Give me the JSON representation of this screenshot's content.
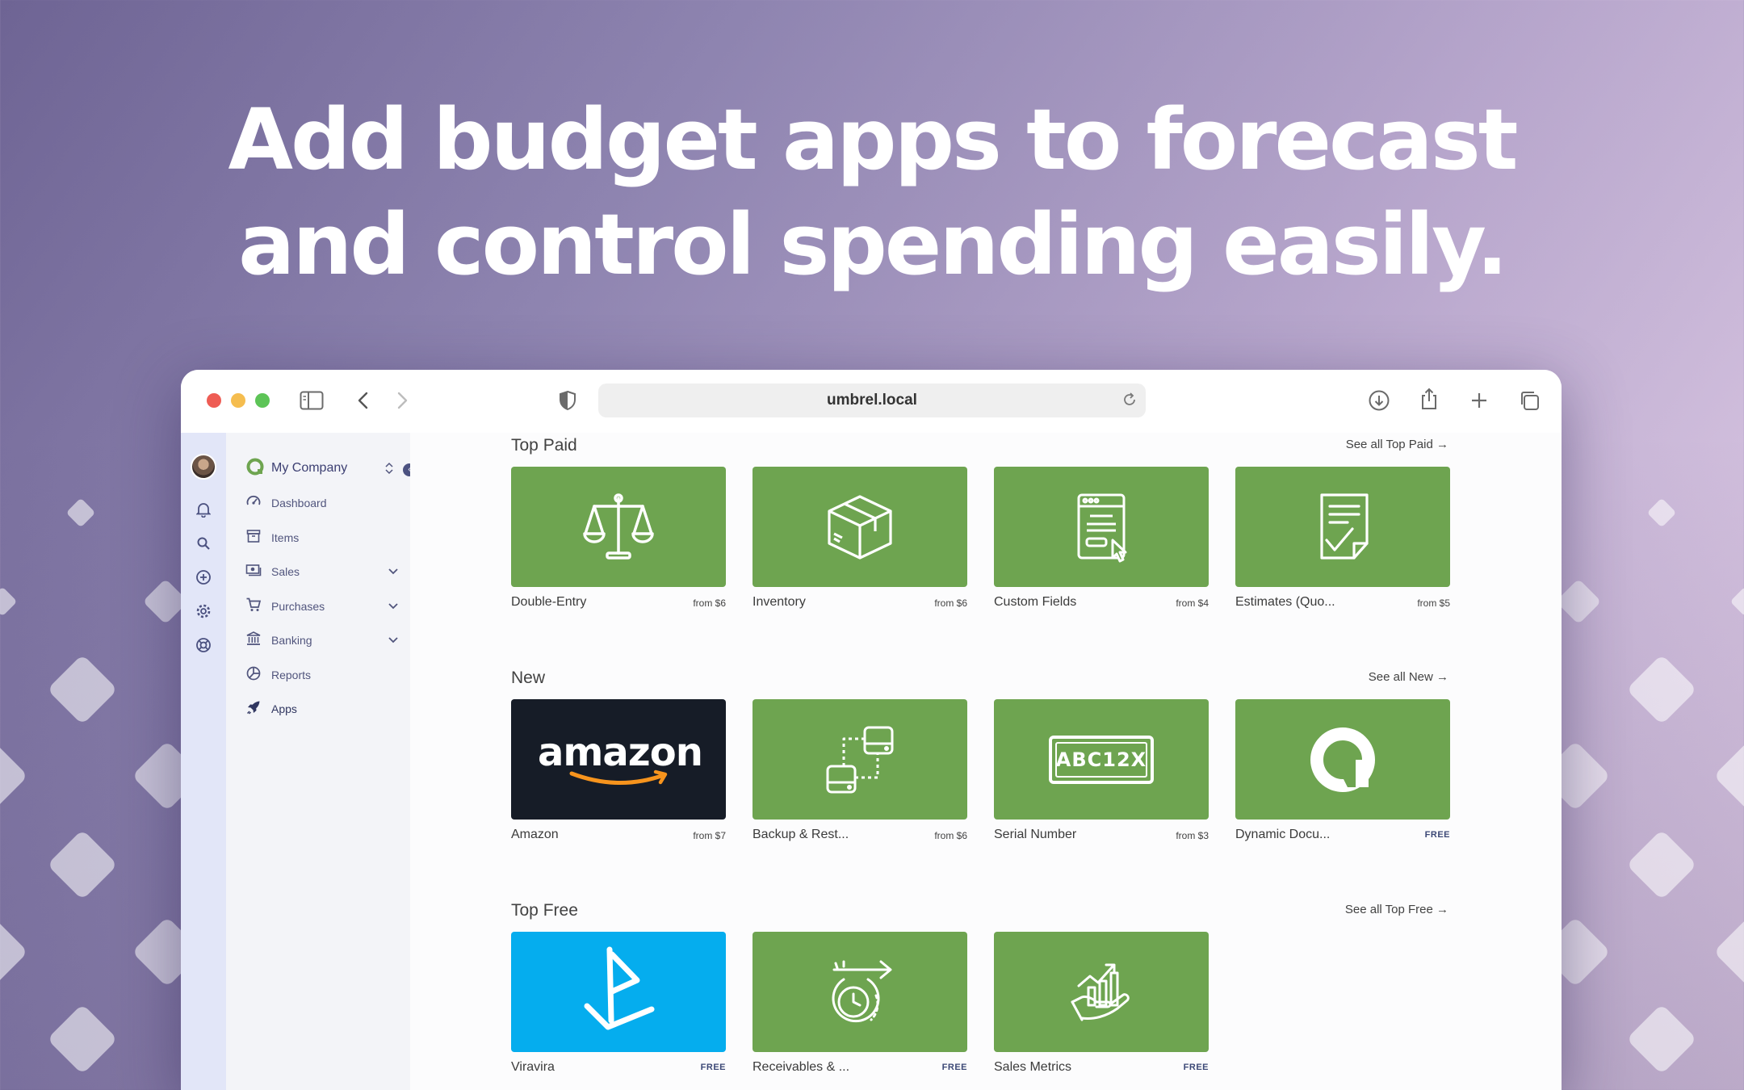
{
  "headline": {
    "line1": "Add budget apps to forecast",
    "line2": "and control spending easily."
  },
  "browser": {
    "url": "umbrel.local"
  },
  "sidebar": {
    "company": "My Company",
    "items": [
      {
        "label": "Dashboard",
        "icon": "gauge-icon"
      },
      {
        "label": "Items",
        "icon": "archive-icon"
      },
      {
        "label": "Sales",
        "icon": "money-icon"
      },
      {
        "label": "Purchases",
        "icon": "cart-icon"
      },
      {
        "label": "Banking",
        "icon": "bank-icon"
      },
      {
        "label": "Reports",
        "icon": "chart-pie-icon"
      },
      {
        "label": "Apps",
        "icon": "rocket-icon"
      }
    ]
  },
  "sections": [
    {
      "title": "Top Paid",
      "see_all": "See all Top Paid →",
      "apps": [
        {
          "name": "Double-Entry",
          "price": "from $6",
          "icon": "scales-icon",
          "bg": "#6ea450"
        },
        {
          "name": "Inventory",
          "price": "from $6",
          "icon": "box-icon",
          "bg": "#6ea450"
        },
        {
          "name": "Custom Fields",
          "price": "from $4",
          "icon": "form-icon",
          "bg": "#6ea450"
        },
        {
          "name": "Estimates (Quo...",
          "price": "from $5",
          "icon": "document-check-icon",
          "bg": "#6ea450"
        }
      ]
    },
    {
      "title": "New",
      "see_all": "See all New →",
      "apps": [
        {
          "name": "Amazon",
          "price": "from $7",
          "icon": "amazon-logo",
          "logo_text": "amazon",
          "bg": "#161c27"
        },
        {
          "name": "Backup & Rest...",
          "price": "from $6",
          "icon": "drives-icon",
          "bg": "#6ea450"
        },
        {
          "name": "Serial Number",
          "price": "from $3",
          "icon": "serial-plate-icon",
          "logo_text": "ABC12X",
          "bg": "#6ea450"
        },
        {
          "name": "Dynamic Docu...",
          "price": "FREE",
          "icon": "akaunting-logo",
          "bg": "#6ea450"
        }
      ]
    },
    {
      "title": "Top Free",
      "see_all": "See all Top Free →",
      "apps": [
        {
          "name": "Viravira",
          "price": "FREE",
          "icon": "sailboat-logo",
          "bg": "#05adee"
        },
        {
          "name": "Receivables & ...",
          "price": "FREE",
          "icon": "clock-arrow-icon",
          "bg": "#6ea450"
        },
        {
          "name": "Sales Metrics",
          "price": "FREE",
          "icon": "hand-chart-icon",
          "bg": "#6ea450"
        }
      ]
    }
  ]
}
